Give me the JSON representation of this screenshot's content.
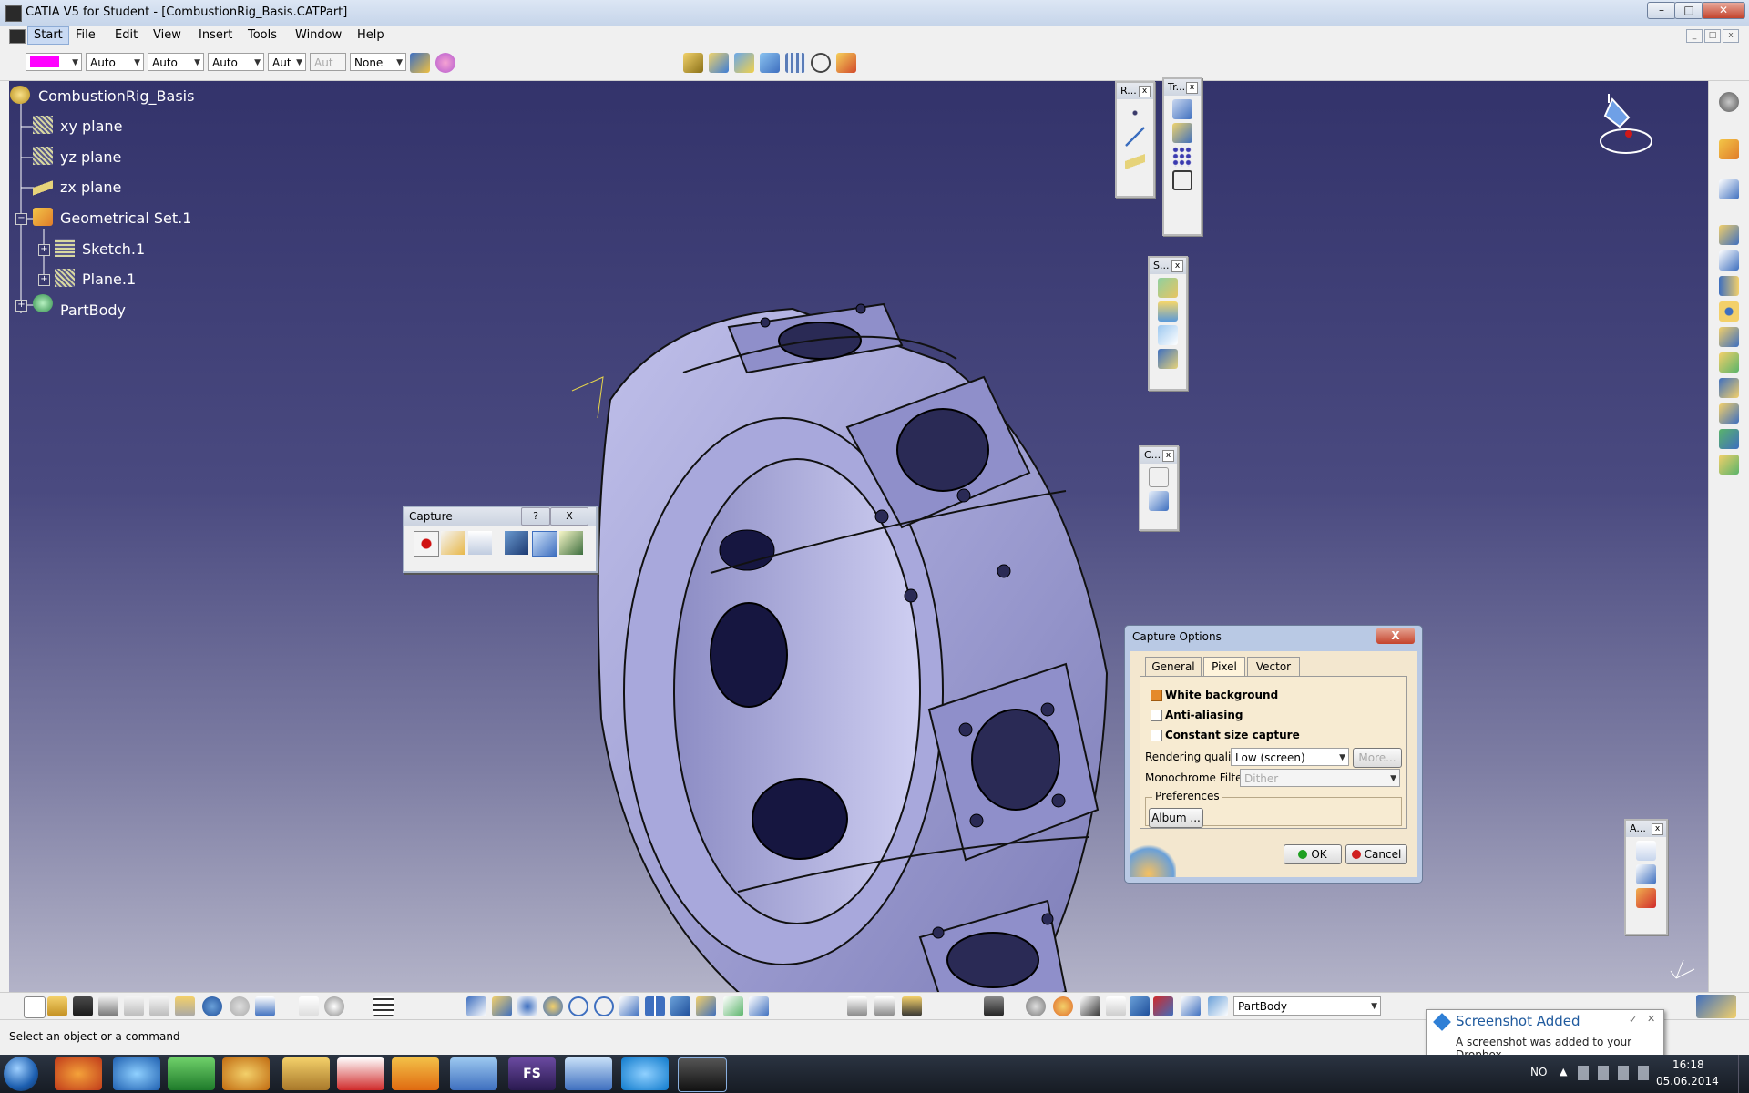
{
  "window": {
    "title": "CATIA V5 for Student - [CombustionRig_Basis.CATPart]",
    "minimize_label": "–",
    "maximize_label": "□",
    "close_label": "✕"
  },
  "menu": {
    "items": [
      "Start",
      "File",
      "Edit",
      "View",
      "Insert",
      "Tools",
      "Window",
      "Help"
    ]
  },
  "graphic_properties": {
    "color_hex": "#ff00ff",
    "line_type": "Auto",
    "thickness": "Auto",
    "point_symbol": "Auto",
    "combo4": "Aut",
    "combo5": "Aut",
    "layer": "None"
  },
  "tree": {
    "root": "CombustionRig_Basis",
    "items": [
      {
        "label": "xy plane"
      },
      {
        "label": "yz plane"
      },
      {
        "label": "zx plane"
      },
      {
        "label": "Geometrical Set.1"
      },
      {
        "label": "Sketch.1"
      },
      {
        "label": "Plane.1"
      },
      {
        "label": "PartBody"
      }
    ]
  },
  "floating_toolbars": {
    "ref": "R...",
    "transform": "Tr...",
    "s": "S...",
    "c": "C...",
    "a": "A...",
    "close": "x"
  },
  "capture_toolbar": {
    "title": "Capture",
    "help": "?",
    "close": "X"
  },
  "capture_options": {
    "title": "Capture Options",
    "close": "X",
    "tabs": [
      "General",
      "Pixel",
      "Vector"
    ],
    "options": [
      {
        "label": "White background",
        "checked": true
      },
      {
        "label": "Anti-aliasing",
        "checked": false
      },
      {
        "label": "Constant size capture",
        "checked": false
      }
    ],
    "rendering_quality_label": "Rendering quality",
    "rendering_quality_value": "Low (screen)",
    "more_button": "More...",
    "monochrome_label": "Monochrome Filter",
    "monochrome_value": "Dither",
    "preferences_label": "Preferences",
    "album_button": "Album ...",
    "ok_button": "OK",
    "cancel_button": "Cancel"
  },
  "bottom_toolbar": {
    "current_body": "PartBody"
  },
  "status": {
    "text": "Select an object or a command"
  },
  "notification": {
    "title": "Screenshot Added",
    "message": "A screenshot was added to your Dropbox."
  },
  "taskbar": {
    "language": "NO",
    "time": "16:18",
    "date": "05.06.2014",
    "fs_label": "FS"
  },
  "colors": {
    "viewport_top": "#33336b",
    "viewport_bottom": "#b3b3c8",
    "part_color": "#a5a5d6"
  }
}
